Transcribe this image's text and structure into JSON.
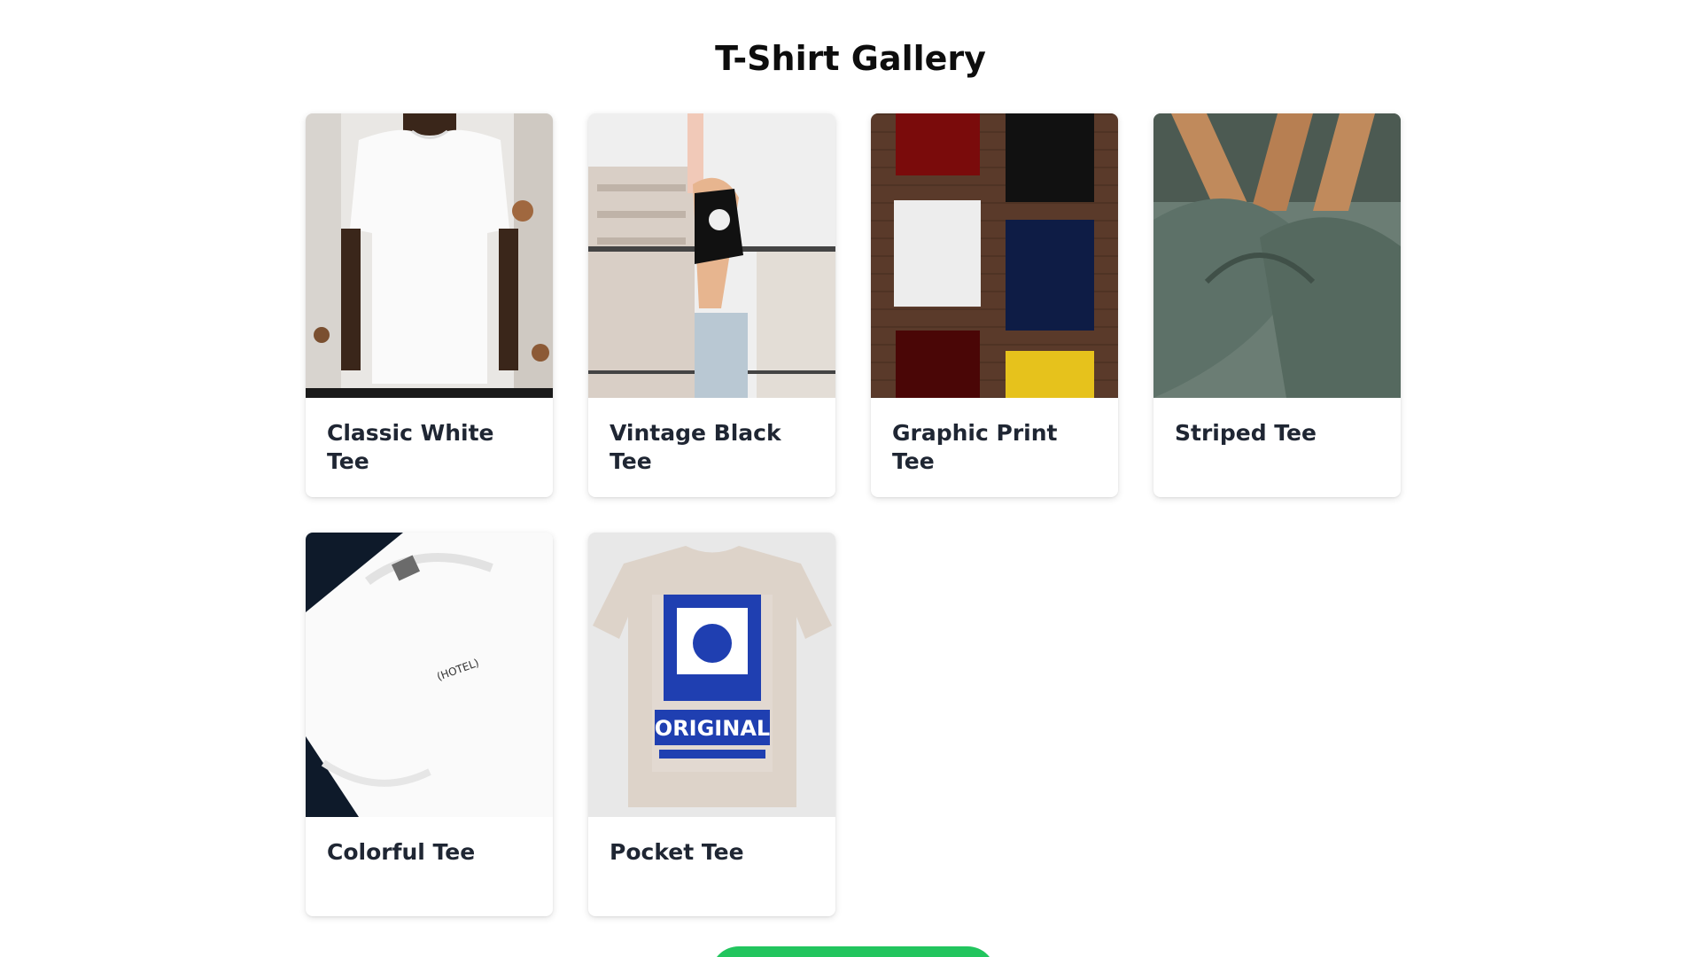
{
  "page": {
    "title": "T-Shirt Gallery"
  },
  "products": [
    {
      "name": "Classic White Tee",
      "image": "white-tee-on-model"
    },
    {
      "name": "Vintage Black Tee",
      "image": "woman-black-crop-tee"
    },
    {
      "name": "Graphic Print Tee",
      "image": "folded-tees-on-wood"
    },
    {
      "name": "Striped Tee",
      "image": "green-tees-on-hangers"
    },
    {
      "name": "Colorful Tee",
      "image": "white-hotel-tee-closeup"
    },
    {
      "name": "Pocket Tee",
      "image": "beige-original-graphic-tee"
    }
  ],
  "colors": {
    "button": "#22c55e",
    "title": "#0d0d0d",
    "card_text": "#1f2633"
  },
  "graphic_text": {
    "hotel": "(HOTEL)",
    "original": "ORIGINAL"
  }
}
